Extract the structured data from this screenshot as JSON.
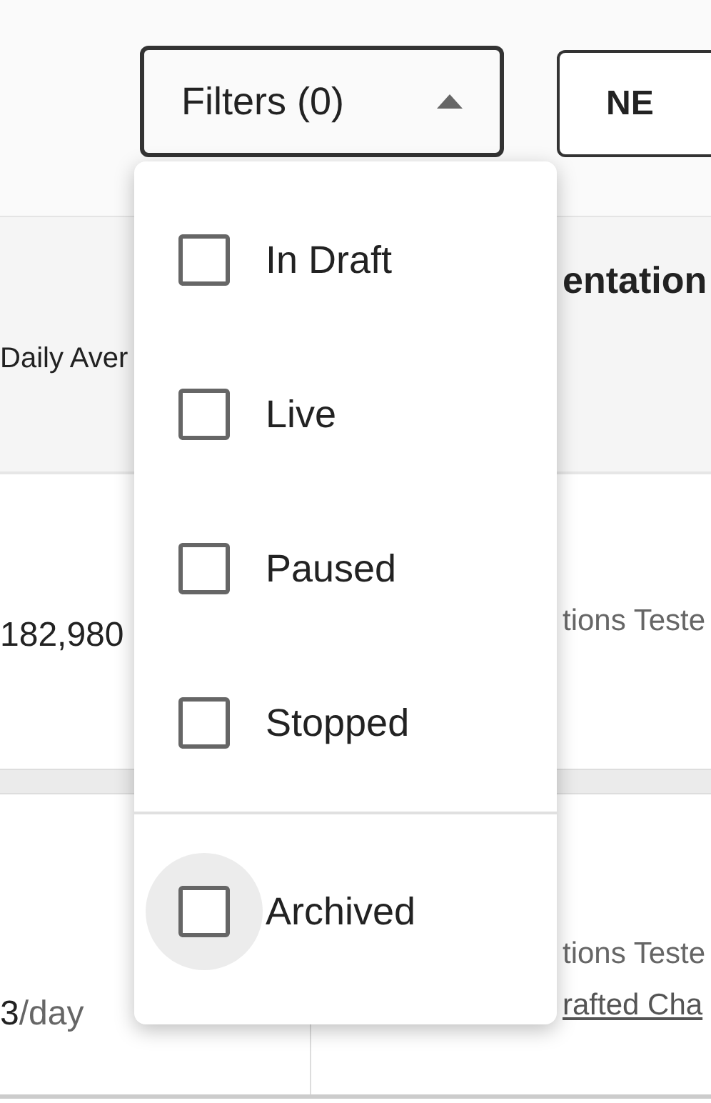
{
  "toolbar": {
    "filter_button": {
      "label": "Filters (0)",
      "expanded": true
    },
    "new_button": {
      "label": "NE"
    }
  },
  "table": {
    "columns": [
      "Daily Aver",
      "entation"
    ],
    "rows": [
      {
        "left": {
          "value": "182,980"
        },
        "right": {
          "text": "tions Teste"
        }
      },
      {
        "left": {
          "value": "3",
          "unit": "/day"
        },
        "right": {
          "text": "tions Teste",
          "link": "rafted Cha"
        }
      }
    ]
  },
  "filter_menu": {
    "items": [
      {
        "label": "In Draft",
        "checked": false,
        "hovered": false,
        "separator_before": false
      },
      {
        "label": "Live",
        "checked": false,
        "hovered": false,
        "separator_before": false
      },
      {
        "label": "Paused",
        "checked": false,
        "hovered": false,
        "separator_before": false
      },
      {
        "label": "Stopped",
        "checked": false,
        "hovered": false,
        "separator_before": false
      },
      {
        "label": "Archived",
        "checked": false,
        "hovered": true,
        "separator_before": true
      }
    ]
  }
}
